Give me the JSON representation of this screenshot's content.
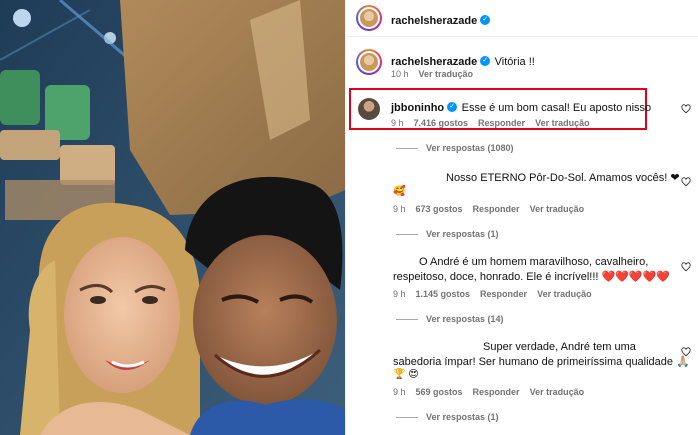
{
  "post": {
    "author": "rachelsherazade",
    "caption_author": "rachelsherazade",
    "caption": "Vitória !!",
    "caption_time": "10 h",
    "caption_translate": "Ver tradução"
  },
  "comments": [
    {
      "author": "jbboninho",
      "verified": true,
      "text": "Esse é um bom casal! Eu aposto nisso",
      "time": "9 h",
      "likes": "7.416 gostos",
      "reply": "Responder",
      "translate": "Ver tradução",
      "view_replies": "Ver respostas (1080)"
    },
    {
      "author": "",
      "text": "Nosso ETERNO Pôr-Do-Sol. Amamos vocês! ❤",
      "emoji_line": "🥰",
      "time": "9 h",
      "likes": "673 gostos",
      "reply": "Responder",
      "translate": "Ver tradução",
      "view_replies": "Ver respostas (1)"
    },
    {
      "author": "",
      "text_line1": "O André é um homem maravilhoso, cavalheiro,",
      "text_line2": "respeitoso, doce, honrado. Ele é incrível!!! ❤️❤️❤️❤️❤️",
      "time": "9 h",
      "likes": "1.145 gostos",
      "reply": "Responder",
      "translate": "Ver tradução",
      "view_replies": "Ver respostas (14)"
    },
    {
      "author": "",
      "text_line1": "Super verdade, André tem uma",
      "text_line2": "sabedoria ímpar! Ser humano de primeiríssima qualidade 🙏🏼",
      "emoji_line": "🏆 😍",
      "time": "9 h",
      "likes": "569 gostos",
      "reply": "Responder",
      "translate": "Ver tradução",
      "view_replies": "Ver respostas (1)"
    }
  ],
  "icons": {
    "verified": "verified-badge-icon",
    "like": "heart-icon"
  },
  "colors": {
    "highlight": "#e3001b",
    "verified": "#0095f6",
    "meta": "#737373"
  }
}
